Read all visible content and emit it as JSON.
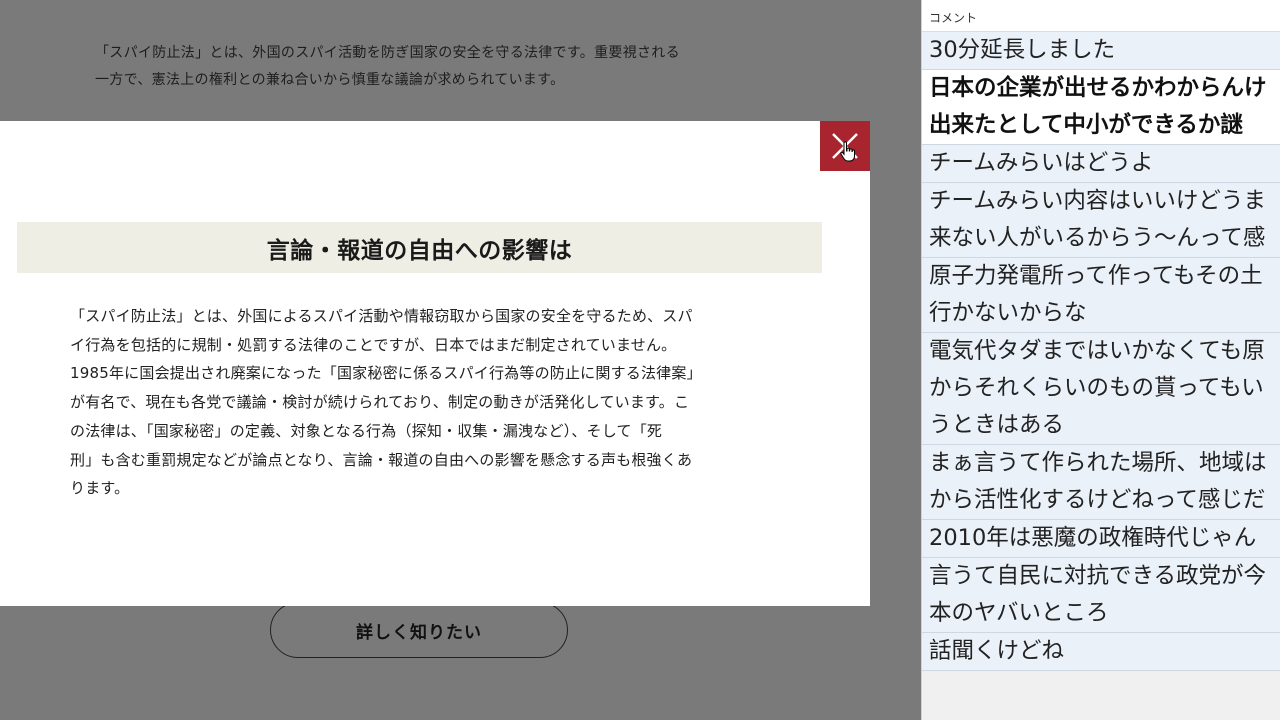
{
  "background": {
    "intro_lines": [
      "「スパイ防止法」とは、外国のスパイ活動を防ぎ国家の安全を守る法律です。重要視される",
      "一方で、憲法上の権利との兼ね合いから慎重な議論が求められています。"
    ],
    "learn_more_label": "詳しく知りたい"
  },
  "modal": {
    "heading": "言論・報道の自由への影響は",
    "body_lines": [
      "「スパイ防止法」とは、外国によるスパイ活動や情報窃取から国家の安全を守るため、スパ",
      "イ行為を包括的に規制・処罰する法律のことですが、日本ではまだ制定されていません。",
      "1985年に国会提出され廃案になった「国家秘密に係るスパイ行為等の防止に関する法律案」",
      "が有名で、現在も各党で議論・検討が続けられており、制定の動きが活発化しています。こ",
      "の法律は、「国家秘密」の定義、対象となる行為（探知・収集・漏洩など）、そして「死",
      "刑」も含む重罰規定などが論点となり、言論・報道の自由への影響を懸念する声も根強くあ",
      "ります。"
    ],
    "close_icon": "close-icon",
    "close_color": "#a8252f"
  },
  "comments": {
    "header": "コメント",
    "items": [
      {
        "lines": [
          "30分延長しました"
        ],
        "bold": false
      },
      {
        "lines": [
          "日本の企業が出せるかわからんけ",
          "出来たとして中小ができるか謎"
        ],
        "bold": true
      },
      {
        "lines": [
          "チームみらいはどうよ"
        ],
        "bold": false
      },
      {
        "lines": [
          "チームみらい内容はいいけどうま",
          "来ない人がいるからう～んって感"
        ],
        "bold": false
      },
      {
        "lines": [
          "原子力発電所って作ってもその土",
          "行かないからな"
        ],
        "bold": false
      },
      {
        "lines": [
          "電気代タダまではいかなくても原",
          "からそれくらいのもの貰ってもい",
          "うときはある"
        ],
        "bold": false
      },
      {
        "lines": [
          "まぁ言うて作られた場所、地域は",
          "から活性化するけどねって感じだ"
        ],
        "bold": false
      },
      {
        "lines": [
          "2010年は悪魔の政権時代じゃん"
        ],
        "bold": false
      },
      {
        "lines": [
          "言うて自民に対抗できる政党が今",
          "本のヤバいところ"
        ],
        "bold": false
      },
      {
        "lines": [
          "話聞くけどね"
        ],
        "bold": false
      }
    ]
  }
}
